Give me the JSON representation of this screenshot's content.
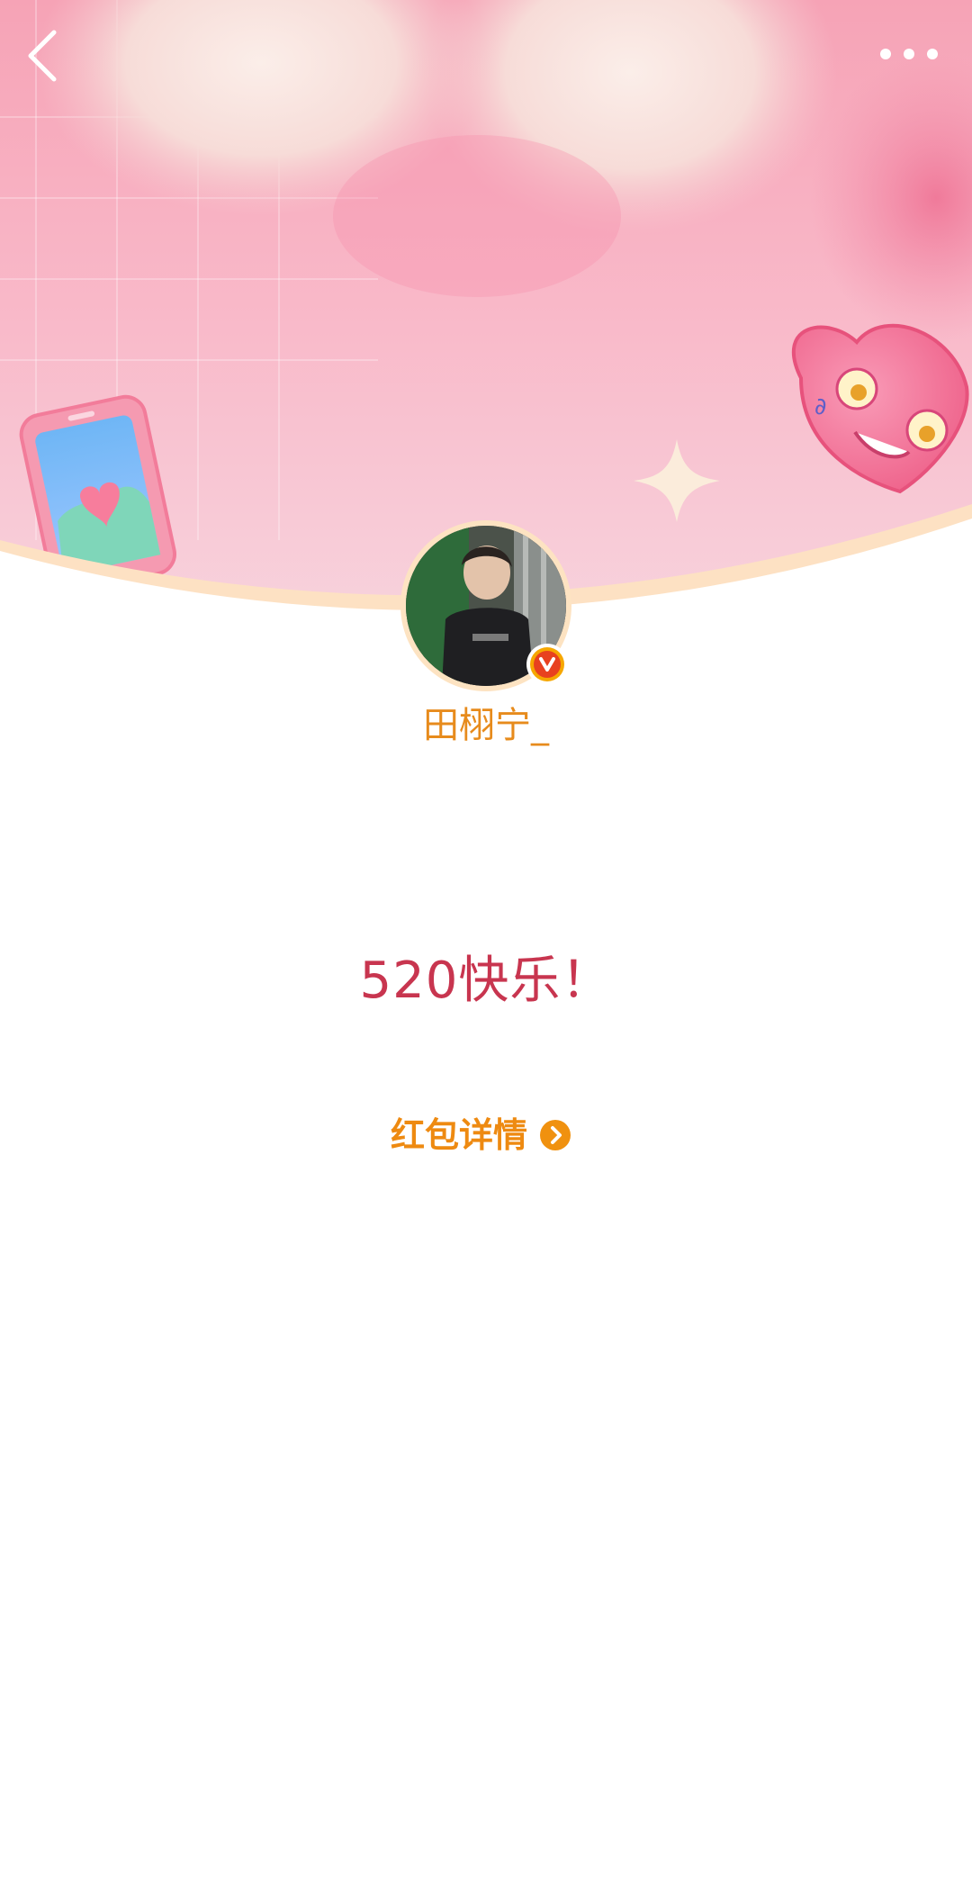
{
  "nav": {
    "back_icon": "chevron-left-icon",
    "more_icon": "more-horizontal-icon"
  },
  "sender": {
    "name": "田栩宁_",
    "verified_badge": "V",
    "name_color": "#e78b1c"
  },
  "greeting": {
    "message": "520快乐！",
    "color": "#c8354f"
  },
  "details": {
    "label": "红包详情",
    "icon": "chevron-right-circle-icon",
    "color": "#ee8a11"
  }
}
